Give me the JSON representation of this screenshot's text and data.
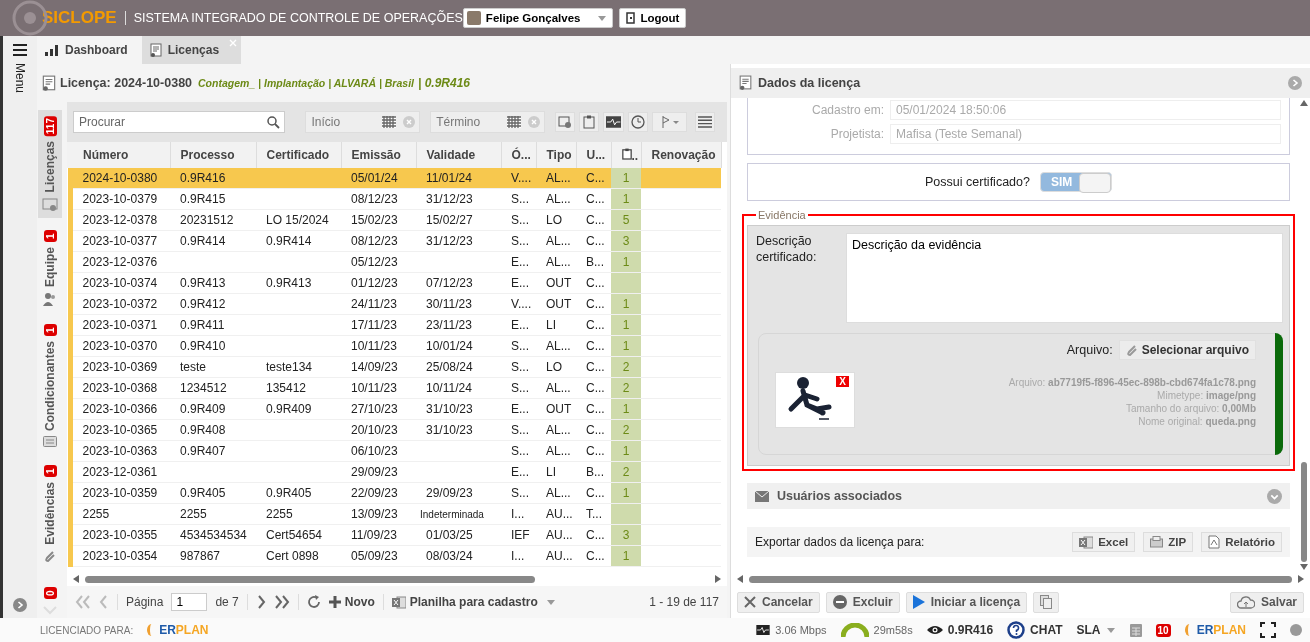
{
  "header": {
    "logo": "SICLOPE",
    "title": "SISTEMA INTEGRADO DE CONTROLE DE OPERAÇÕES",
    "user": "Felipe Gonçalves",
    "logout": "Logout"
  },
  "menu": {
    "label": "Menu"
  },
  "tabs": [
    {
      "label": "Dashboard",
      "selected": false
    },
    {
      "label": "Licenças",
      "selected": true
    }
  ],
  "license": {
    "title": "Licença: 2024-10-0380",
    "meta": "Contagem_ | Implantação | ALVARÁ | Brasil",
    "code": "| 0.9R416"
  },
  "side_tabs": [
    {
      "label": "Licenças",
      "badge": "117",
      "selected": true,
      "kind": "license"
    },
    {
      "label": "Equipe",
      "badge": "1",
      "selected": false,
      "kind": "team"
    },
    {
      "label": "Condicionantes",
      "badge": "1",
      "selected": false,
      "kind": "conditions"
    },
    {
      "label": "Evidências",
      "badge": "1",
      "selected": false,
      "kind": "evidence"
    },
    {
      "badge": "0",
      "selected": false,
      "kind": "more"
    }
  ],
  "toolbar": {
    "search_placeholder": "Procurar",
    "start_placeholder": "Início",
    "end_placeholder": "Término"
  },
  "table": {
    "columns": [
      "Número",
      "Processo",
      "Certificado",
      "Emissão",
      "Validade",
      "Ó...",
      "Tipo",
      "U...",
      "..",
      "Renovação"
    ],
    "rows": [
      {
        "selected": true,
        "cells": [
          "2024-10-0380",
          "0.9R416",
          null,
          "05/01/24",
          "11/01/24",
          "V....",
          "AL...",
          "C...",
          "1",
          null
        ]
      },
      {
        "selected": false,
        "cells": [
          "2023-10-0379",
          "0.9R415",
          null,
          "08/12/23",
          "31/12/23",
          "S...",
          "AL...",
          "C...",
          "1",
          null
        ]
      },
      {
        "selected": false,
        "cells": [
          "2023-12-0378",
          "20231512",
          "LO 15/2024",
          "15/02/23",
          "15/02/27",
          "S...",
          "LO",
          "C...",
          "5",
          null
        ]
      },
      {
        "selected": false,
        "cells": [
          "2023-10-0377",
          "0.9R414",
          "0.9R414",
          "08/12/23",
          "31/12/23",
          "S...",
          "AL...",
          "C...",
          "3",
          null
        ]
      },
      {
        "selected": false,
        "cells": [
          "2023-12-0376",
          null,
          null,
          "05/12/23",
          null,
          "E...",
          "AL...",
          "B...",
          "1",
          null
        ]
      },
      {
        "selected": false,
        "cells": [
          "2023-10-0374",
          "0.9R413",
          "0.9R413",
          "01/12/23",
          "07/12/23",
          "E...",
          "OUT",
          "C...",
          null,
          null
        ]
      },
      {
        "selected": false,
        "cells": [
          "2023-10-0372",
          "0.9R412",
          null,
          "24/11/23",
          "30/11/23",
          "V....",
          "OUT",
          "C...",
          "1",
          null
        ]
      },
      {
        "selected": false,
        "cells": [
          "2023-10-0371",
          "0.9R411",
          null,
          "17/11/23",
          "23/11/23",
          "E...",
          "LI",
          "C...",
          "1",
          null
        ]
      },
      {
        "selected": false,
        "cells": [
          "2023-10-0370",
          "0.9R410",
          null,
          "10/11/23",
          "10/01/24",
          "S...",
          "AL...",
          "C...",
          "1",
          null
        ]
      },
      {
        "selected": false,
        "cells": [
          "2023-10-0369",
          "teste",
          "teste134",
          "14/09/23",
          "25/08/24",
          "S...",
          "LO",
          "C...",
          "2",
          null
        ]
      },
      {
        "selected": false,
        "cells": [
          "2023-10-0368",
          "1234512",
          "135412",
          "10/11/23",
          "10/11/24",
          "S...",
          "AL...",
          "C...",
          "2",
          null
        ]
      },
      {
        "selected": false,
        "cells": [
          "2023-10-0366",
          "0.9R409",
          "0.9R409",
          "27/10/23",
          "31/10/23",
          "E...",
          "OUT",
          "C...",
          "1",
          null
        ]
      },
      {
        "selected": false,
        "cells": [
          "2023-10-0365",
          "0.9R408",
          null,
          "20/10/23",
          "31/10/23",
          "S...",
          "AL...",
          "C...",
          "2",
          null
        ]
      },
      {
        "selected": false,
        "cells": [
          "2023-10-0363",
          "0.9R407",
          null,
          "06/10/23",
          null,
          "S...",
          "AL...",
          "C...",
          "1",
          null
        ]
      },
      {
        "selected": false,
        "cells": [
          "2023-12-0361",
          null,
          null,
          "29/09/23",
          null,
          "E...",
          "LI",
          "B...",
          "2",
          null
        ]
      },
      {
        "selected": false,
        "cells": [
          "2023-10-0359",
          "0.9R405",
          "0.9R405",
          "22/09/23",
          "29/09/23",
          "S...",
          "AL...",
          "C...",
          "1",
          null
        ]
      },
      {
        "selected": false,
        "cells": [
          "2255",
          "2255",
          "2255",
          "13/09/23",
          "Indeterminada",
          "I...",
          "AU...",
          "T...",
          null,
          null
        ]
      },
      {
        "selected": false,
        "cells": [
          "2023-10-0355",
          "4534534534",
          "Cert54654",
          "11/09/23",
          "01/03/25",
          "IEF",
          "AU...",
          "C...",
          "3",
          null
        ]
      },
      {
        "selected": false,
        "cells": [
          "2023-10-0354",
          "987867",
          "Cert 0898",
          "05/09/23",
          "08/03/24",
          "I...",
          "AU...",
          "C...",
          "1",
          null
        ]
      }
    ]
  },
  "pager": {
    "page_label": "Página",
    "page": "1",
    "of": "de 7",
    "new": "Novo",
    "sheet": "Planilha para cadastro",
    "range": "1 - 19 de 117"
  },
  "details": {
    "title": "Dados da licença",
    "fields": [
      {
        "label": "Cadastro em:",
        "value": "05/01/2024 18:50:06"
      },
      {
        "label": "Projetista:",
        "value": "Mafisa (Teste Semanal)"
      }
    ],
    "certificate": {
      "label": "Possui certificado?",
      "toggle": "SIM",
      "on": true
    },
    "evidence": {
      "legend": "Evidência",
      "highlighted": true,
      "description_label": "Descrição certificado:",
      "description": "Descrição da evidência",
      "file_label": "Arquivo:",
      "select_button": "Selecionar arquivo",
      "remove": "X",
      "info": [
        {
          "label": "Arquivo:",
          "value": "ab7719f5-f896-45ec-898b-cbd674fa1c78.png"
        },
        {
          "label": "Mimetype:",
          "value": "image/png"
        },
        {
          "label": "Tamanho do arquivo:",
          "value": "0,00Mb"
        },
        {
          "label": "Nome original:",
          "value": "queda.png"
        }
      ]
    },
    "users": "Usuários associados",
    "export": {
      "label": "Exportar dados da licença para:",
      "buttons": [
        {
          "label": "Excel",
          "kind": "excel"
        },
        {
          "label": "ZIP",
          "kind": "zip"
        },
        {
          "label": "Relatório",
          "kind": "pdf"
        }
      ]
    }
  },
  "actions": [
    {
      "label": "Cancelar",
      "kind": "cancel"
    },
    {
      "label": "Excluir",
      "kind": "delete"
    },
    {
      "label": "Iniciar a licença",
      "kind": "start"
    },
    {
      "kind": "copy"
    },
    {
      "label": "Salvar",
      "kind": "save"
    }
  ],
  "footer": {
    "licensed": "LICENCIADO PARA:",
    "logo_a": "ER",
    "logo_b": "PLAN"
  },
  "status": {
    "speed": "3.06 Mbps",
    "timer": "29m58s",
    "viewing": "0.9R416",
    "chat": "CHAT",
    "sla": "SLA",
    "count": "10",
    "logo_a": "ER",
    "logo_b": "PLAN"
  }
}
